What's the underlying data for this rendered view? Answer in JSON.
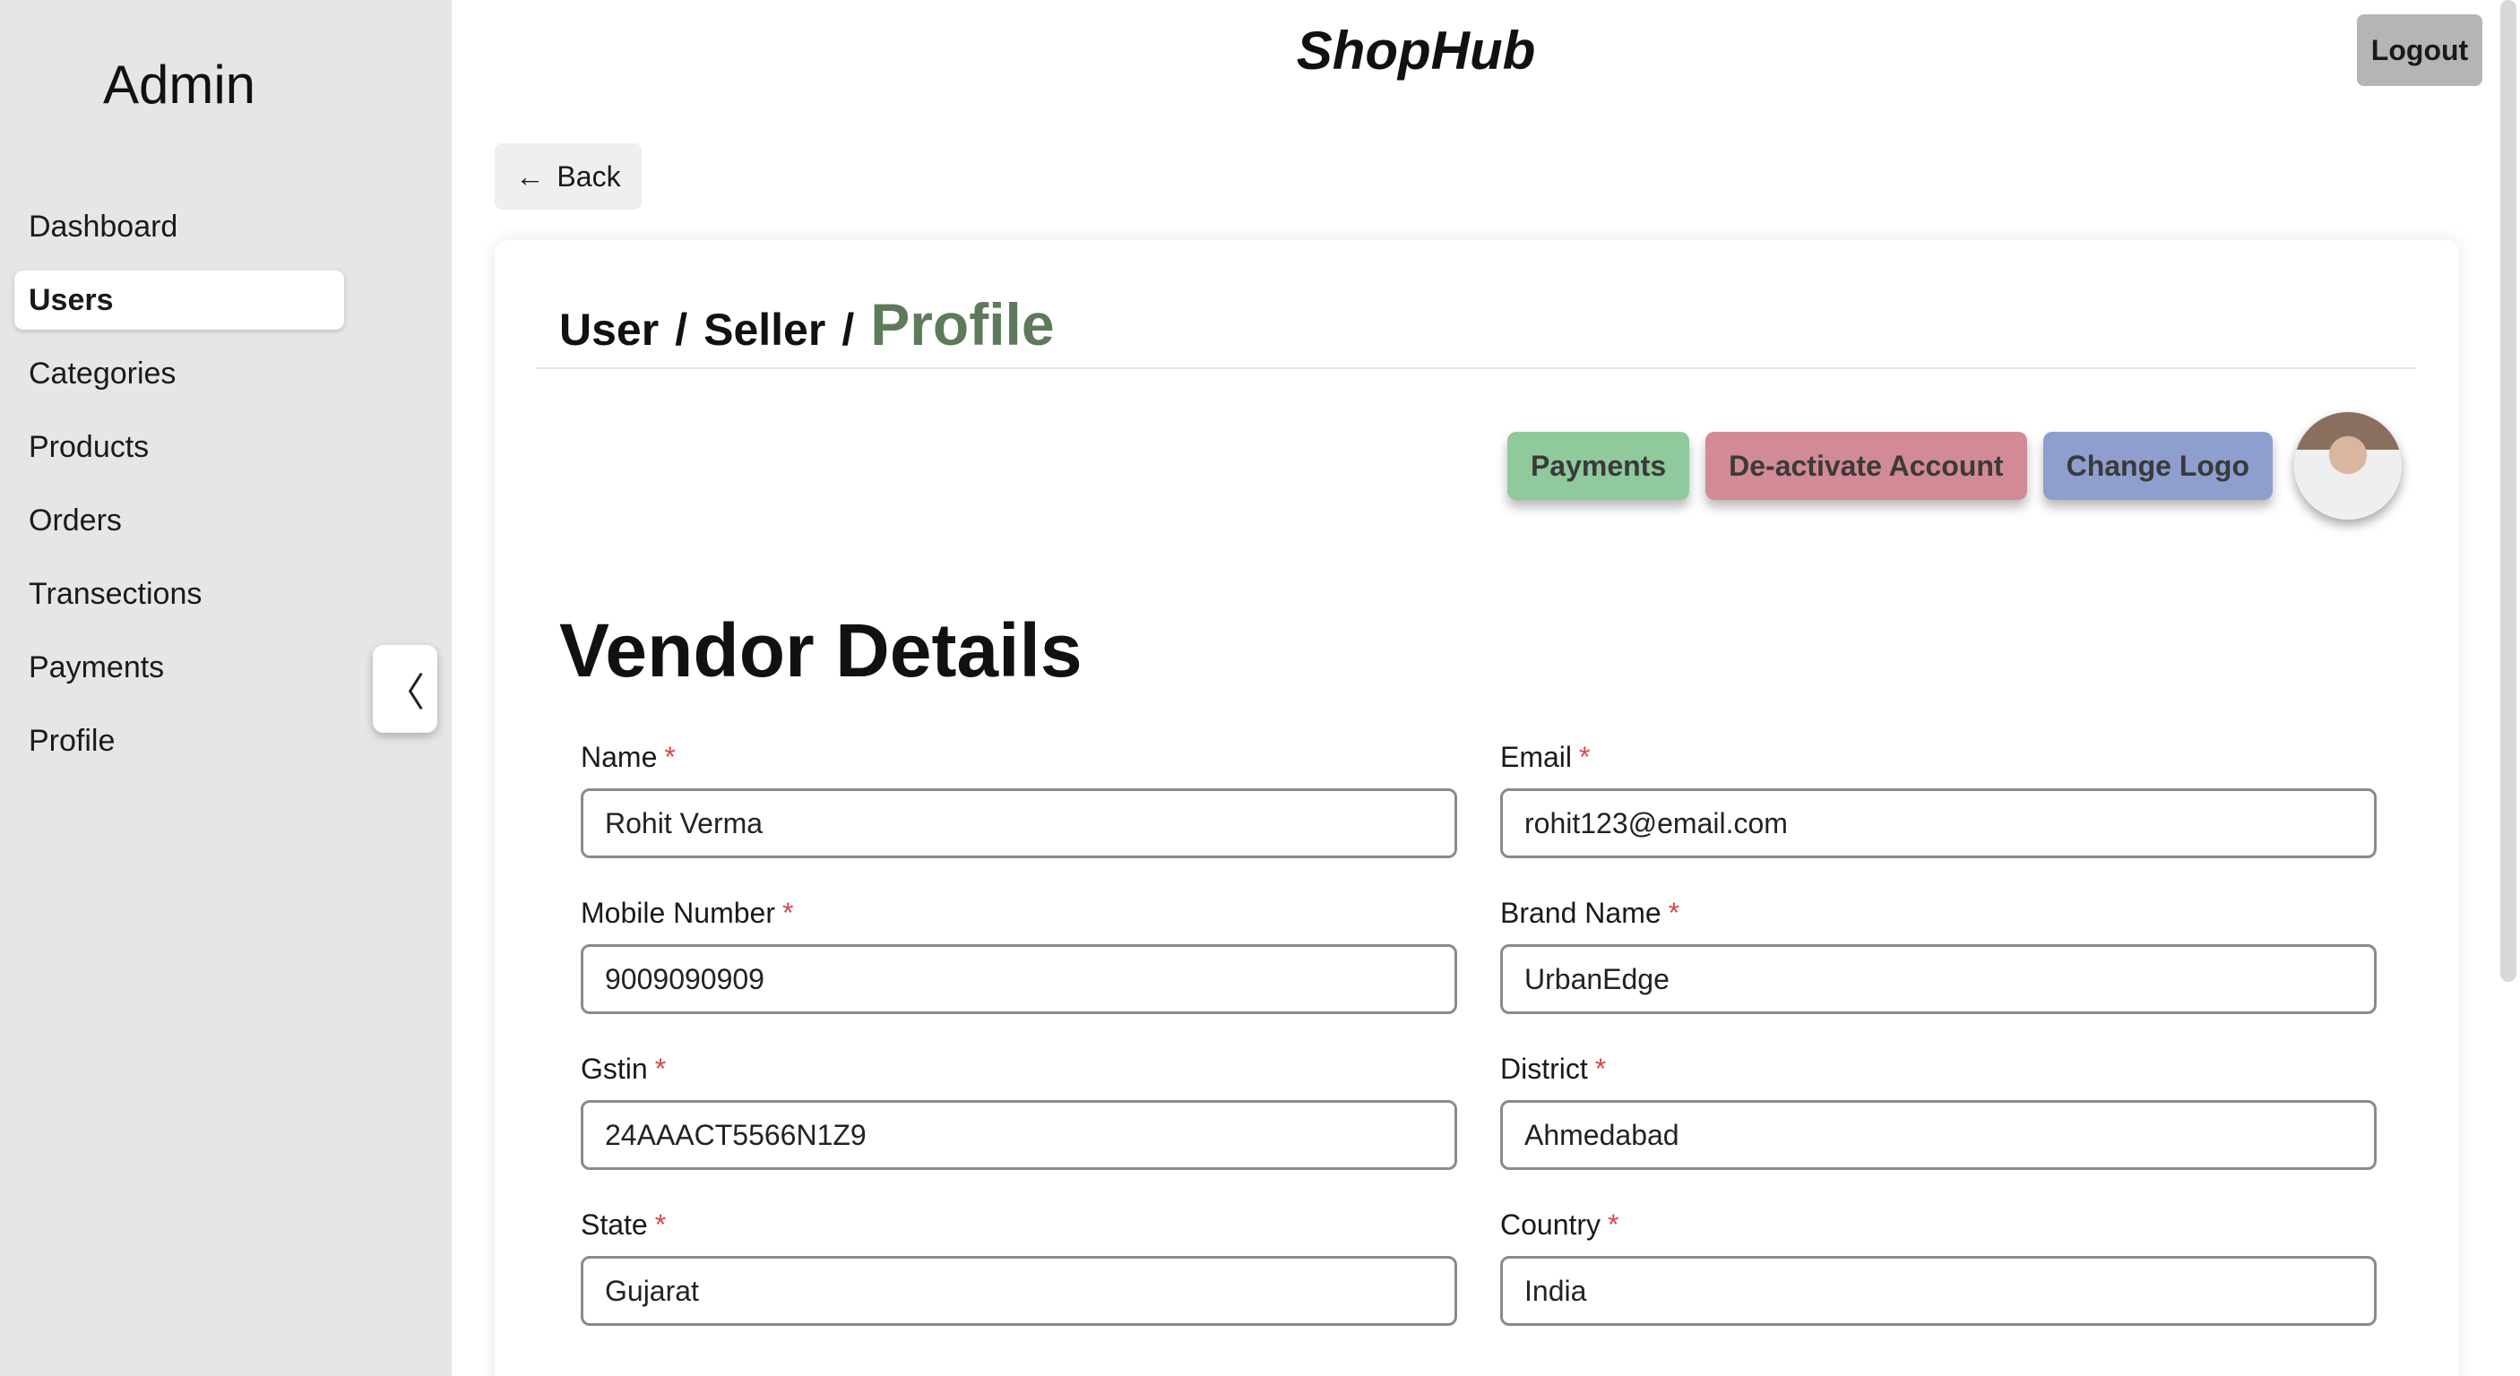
{
  "sidebar": {
    "title": "Admin",
    "items": [
      {
        "label": "Dashboard",
        "active": false
      },
      {
        "label": "Users",
        "active": true
      },
      {
        "label": "Categories",
        "active": false
      },
      {
        "label": "Products",
        "active": false
      },
      {
        "label": "Orders",
        "active": false
      },
      {
        "label": "Transections",
        "active": false
      },
      {
        "label": "Payments",
        "active": false
      },
      {
        "label": "Profile",
        "active": false
      }
    ],
    "collapse_icon": "chevron-left-icon",
    "collapse_glyph": "〈"
  },
  "header": {
    "brand": "ShopHub",
    "logout_label": "Logout"
  },
  "back": {
    "label": "Back",
    "icon": "arrow-left-icon",
    "glyph": "←"
  },
  "profile": {
    "breadcrumb": [
      "User",
      "Seller"
    ],
    "separator": "/",
    "current": "Profile",
    "actions": {
      "payments_label": "Payments",
      "deactivate_label": "De-activate Account",
      "change_logo_label": "Change Logo"
    },
    "section_title": "Vendor Details",
    "required_marker": "*",
    "fields": [
      {
        "label": "Name",
        "value": "Rohit Verma"
      },
      {
        "label": "Email",
        "value": "rohit123@email.com"
      },
      {
        "label": "Mobile Number",
        "value": "9009090909"
      },
      {
        "label": "Brand Name",
        "value": "UrbanEdge"
      },
      {
        "label": "Gstin",
        "value": "24AAACT5566N1Z9"
      },
      {
        "label": "District",
        "value": "Ahmedabad"
      },
      {
        "label": "State",
        "value": "Gujarat"
      },
      {
        "label": "Country",
        "value": "India"
      }
    ]
  },
  "colors": {
    "payments": "#8fc99c",
    "deactivate": "#d28a96",
    "change_logo": "#8e9ecf",
    "profile_accent": "#5d7a5a",
    "required": "#d84848"
  }
}
